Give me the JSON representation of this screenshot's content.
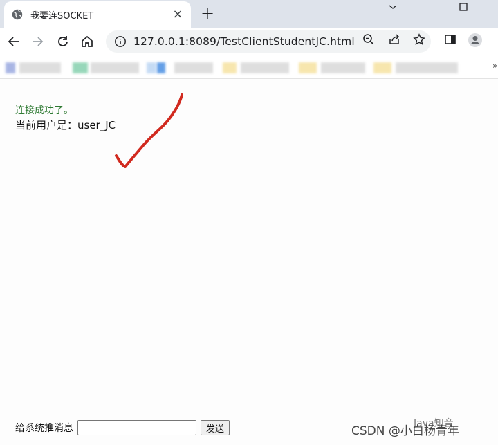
{
  "tab": {
    "title": "我要连SOCKET",
    "close_glyph": "×",
    "icon": "globe-icon"
  },
  "new_tab_glyph": "+",
  "window_controls": {
    "minimize_icon": "chevron-down-icon",
    "maximize_icon": "maximize-icon"
  },
  "toolbar": {
    "back_icon": "arrow-left-icon",
    "forward_icon": "arrow-right-icon",
    "reload_icon": "reload-icon",
    "home_icon": "home-icon",
    "url": "127.0.0.1:8089/TestClientStudentJC.html",
    "actions": [
      "zoom-icon",
      "share-icon",
      "star-icon",
      "side-panel-icon",
      "profile-icon"
    ]
  },
  "bookmarks_more": "»",
  "page": {
    "status_text": "连接成功了。",
    "user_text": "当前用户是：user_JC",
    "form": {
      "label": "给系统推消息",
      "input_value": "",
      "send_label": "发送"
    }
  },
  "watermarks": {
    "csdn": "CSDN @小白杨青年",
    "platform": "Java知音"
  },
  "colors": {
    "status_green": "#2f7a33",
    "checkmark_red": "#d12a1f",
    "tabstrip": "#dee3eb"
  }
}
